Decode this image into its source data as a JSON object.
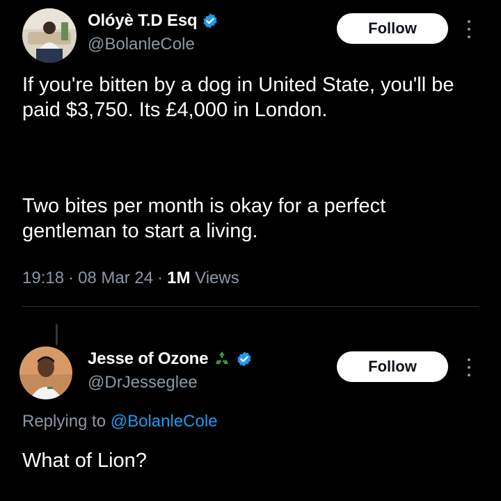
{
  "main_tweet": {
    "author": {
      "display_name": "Olóyè T.D Esq",
      "handle": "@BolanleCole",
      "verified": true
    },
    "follow_label": "Follow",
    "paragraphs": [
      "If you're bitten by a dog in United State, you'll be paid $3,750. Its £4,000 in London.",
      "Two bites per month is okay for a perfect gentleman to start a living."
    ],
    "time": "19:18",
    "date": "08 Mar 24",
    "separator": "·",
    "views_count": "1M",
    "views_label": "Views"
  },
  "reply_tweet": {
    "author": {
      "display_name": "Jesse of Ozone",
      "handle": "@DrJesseglee",
      "verified": true,
      "emoji_icon": "recycle-icon"
    },
    "follow_label": "Follow",
    "replying_prefix": "Replying to",
    "replying_to": "@BolanleCole",
    "text": "What of Lion?"
  },
  "colors": {
    "background": "#000000",
    "text": "#ffffff",
    "secondary_text": "#8b98a5",
    "verified_blue": "#1d9bf0",
    "follow_bg": "#ffffff",
    "recycle_green": "#3a9a3a"
  }
}
